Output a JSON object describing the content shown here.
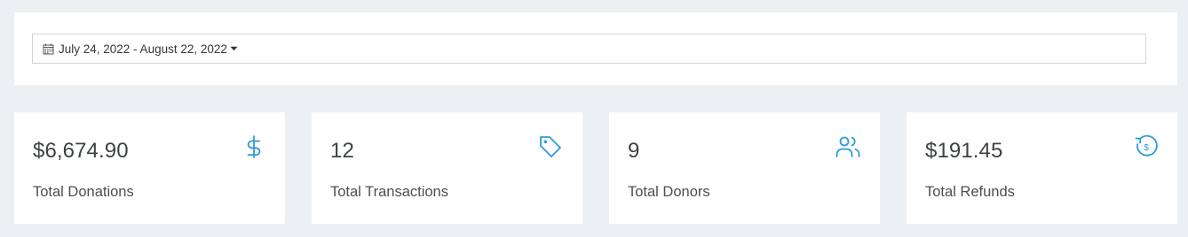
{
  "date_filter": {
    "range_label": "July 24, 2022 - August 22, 2022",
    "calendar_icon": "calendar-icon",
    "caret_icon": "caret-down-icon"
  },
  "stats": [
    {
      "value": "$6,674.90",
      "label": "Total Donations",
      "icon": "dollar-icon"
    },
    {
      "value": "12",
      "label": "Total Transactions",
      "icon": "tag-icon"
    },
    {
      "value": "9",
      "label": "Total Donors",
      "icon": "users-icon"
    },
    {
      "value": "$191.45",
      "label": "Total Refunds",
      "icon": "refund-icon"
    }
  ],
  "colors": {
    "accent": "#2b9bd7",
    "background": "#edf0f3",
    "card": "#ffffff"
  }
}
